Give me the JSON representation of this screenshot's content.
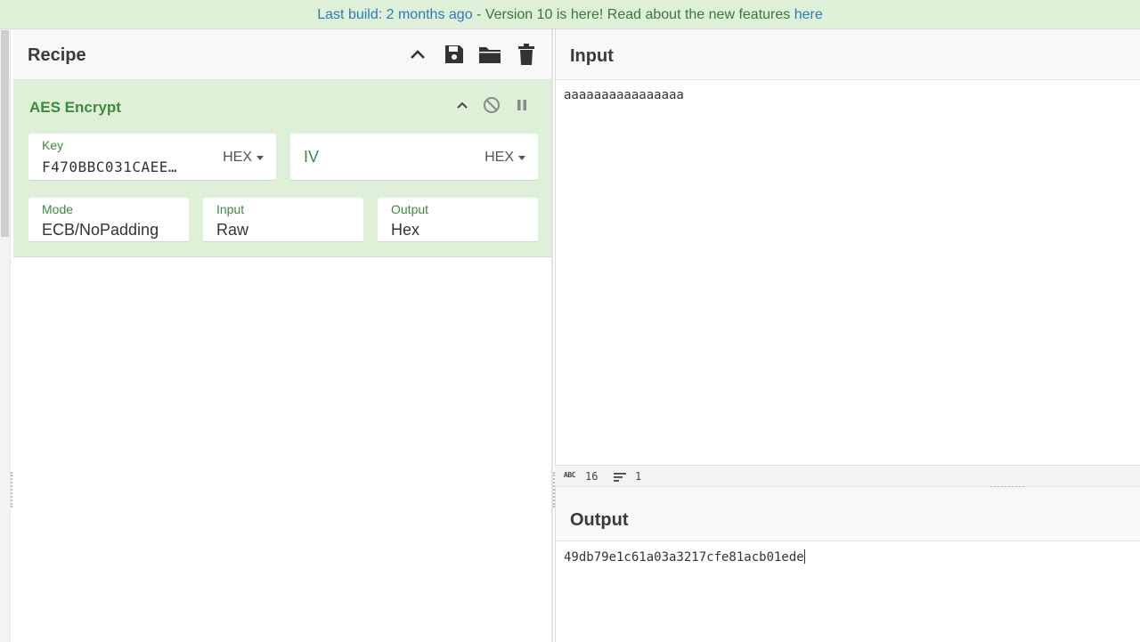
{
  "banner": {
    "last_build": "Last build: 2 months ago",
    "separator": " - Version 10 is here! Read about the new features ",
    "link": "here"
  },
  "recipe": {
    "title": "Recipe",
    "icons": [
      "chevron-up-icon",
      "save-icon",
      "folder-icon",
      "trash-icon"
    ]
  },
  "operation": {
    "name": "AES Encrypt",
    "key": {
      "label": "Key",
      "value": "F470BBC031CAEE…",
      "encoding": "HEX"
    },
    "iv": {
      "placeholder": "IV",
      "encoding": "HEX"
    },
    "mode": {
      "label": "Mode",
      "value": "ECB/NoPadding"
    },
    "input": {
      "label": "Input",
      "value": "Raw"
    },
    "output": {
      "label": "Output",
      "value": "Hex"
    }
  },
  "input_panel": {
    "title": "Input",
    "text": "aaaaaaaaaaaaaaaa"
  },
  "status": {
    "abc": "ABC",
    "char_count": "16",
    "line_count": "1"
  },
  "output_panel": {
    "title": "Output",
    "text": "49db79e1c61a03a3217cfe81acb01ede"
  },
  "colors": {
    "banner_bg": "#dff0d8",
    "op_bg": "#dff0d8",
    "op_title": "#3c8a3e",
    "link": "#2f7ab8"
  }
}
